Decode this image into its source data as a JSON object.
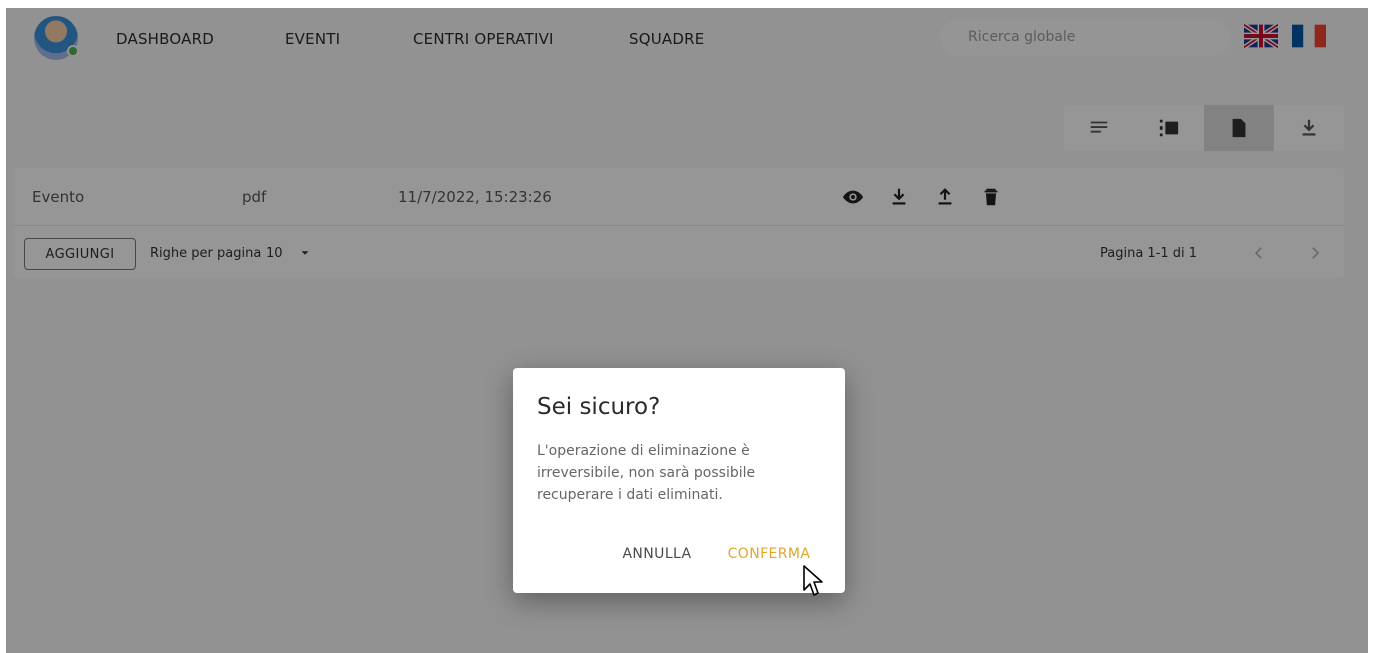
{
  "nav": {
    "items": [
      {
        "label": "DASHBOARD"
      },
      {
        "label": "EVENTI"
      },
      {
        "label": "CENTRI OPERATIVI"
      },
      {
        "label": "SQUADRE"
      }
    ],
    "search_placeholder": "Ricerca globale",
    "flags": [
      "uk-flag-icon",
      "fr-flag-icon"
    ]
  },
  "toolbar": {
    "buttons": [
      "filter-lines-icon",
      "columns-icon",
      "document-icon",
      "download-icon"
    ],
    "active_index": 2
  },
  "table": {
    "rows": [
      {
        "name": "Evento",
        "type": "pdf",
        "date": "11/7/2022, 15:23:26",
        "actions": [
          "view-icon",
          "download-icon",
          "upload-icon",
          "trash-icon"
        ]
      }
    ],
    "footer": {
      "add_label": "AGGIUNGI",
      "rows_per_page_label": "Righe per pagina",
      "rows_per_page_value": "10",
      "page_info": "Pagina 1-1 di 1"
    }
  },
  "dialog": {
    "title": "Sei sicuro?",
    "body": "L'operazione di eliminazione è irreversibile, non sarà possibile recuperare i dati eliminati.",
    "cancel_label": "ANNULLA",
    "confirm_label": "CONFERMA"
  },
  "colors": {
    "accent": "#e0a72a",
    "overlay": "#000000",
    "surface": "#f4f4f4"
  }
}
